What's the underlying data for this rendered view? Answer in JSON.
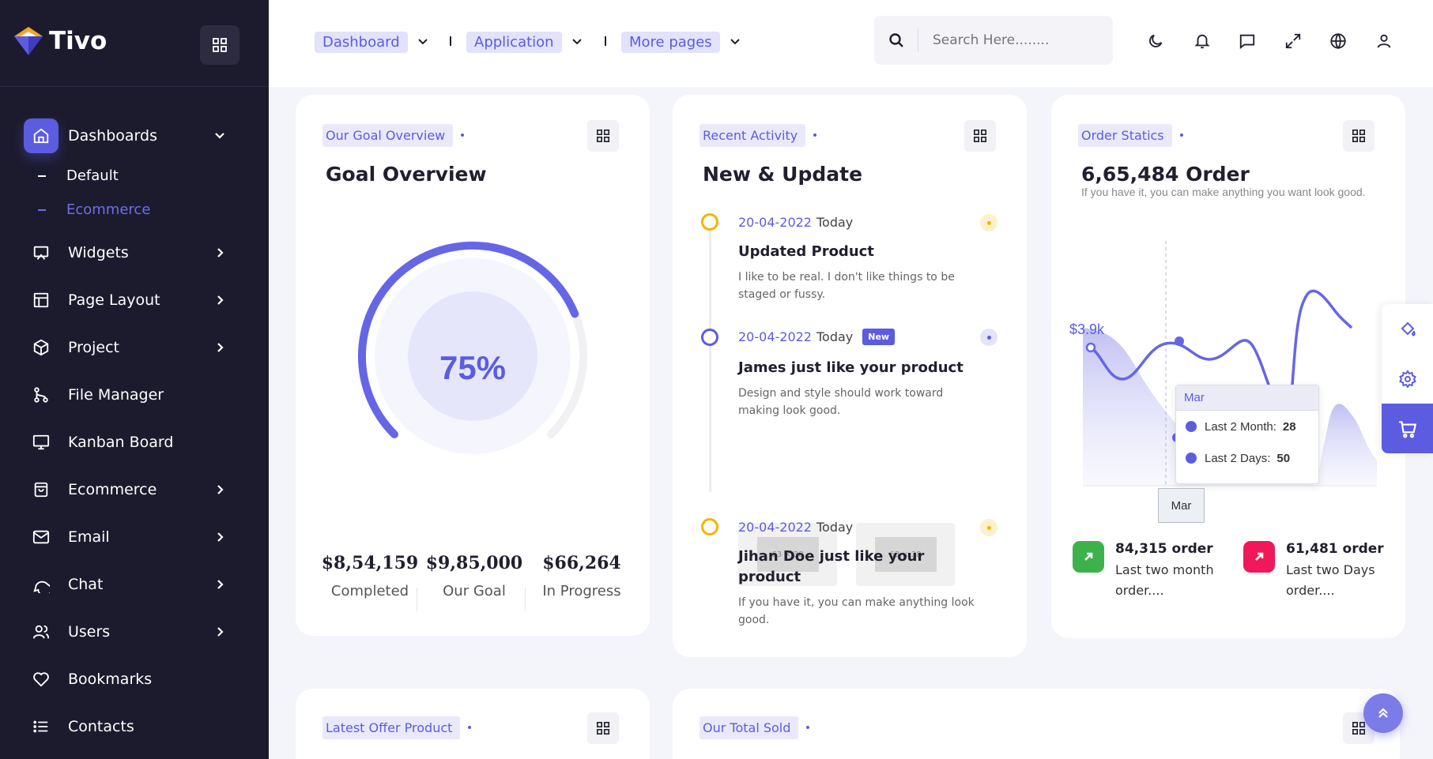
{
  "brand": {
    "name": "Tivo"
  },
  "sidebar": {
    "items": [
      {
        "label": "Dashboards",
        "icon": "home-icon"
      },
      {
        "label": "Widgets",
        "icon": "widget-icon"
      },
      {
        "label": "Page Layout",
        "icon": "layout-icon"
      },
      {
        "label": "Project",
        "icon": "box-icon"
      },
      {
        "label": "File Manager",
        "icon": "git-icon"
      },
      {
        "label": "Kanban Board",
        "icon": "monitor-icon"
      },
      {
        "label": "Ecommerce",
        "icon": "bag-icon"
      },
      {
        "label": "Email",
        "icon": "mail-icon"
      },
      {
        "label": "Chat",
        "icon": "chat-icon"
      },
      {
        "label": "Users",
        "icon": "users-icon"
      },
      {
        "label": "Bookmarks",
        "icon": "heart-icon"
      },
      {
        "label": "Contacts",
        "icon": "list-icon"
      }
    ],
    "sub_items": [
      "Default",
      "Ecommerce"
    ]
  },
  "topbar": {
    "links": [
      "Dashboard",
      "Application",
      "More pages"
    ],
    "search_placeholder": "Search Here........"
  },
  "goal": {
    "tag": "Our Goal Overview",
    "title": "Goal Overview",
    "percent_label": "75%",
    "percent": 75,
    "stats": [
      {
        "value": "$8,54,159",
        "label": "Completed"
      },
      {
        "value": "$9,85,000",
        "label": "Our Goal"
      },
      {
        "value": "$66,264",
        "label": "In Progress"
      }
    ]
  },
  "activity": {
    "tag": "Recent Activity",
    "title": "New & Update",
    "items": [
      {
        "date": "20-04-2022",
        "day": "Today",
        "title": "Updated Product",
        "desc": "I like to be real. I don't like things to be staged or fussy."
      },
      {
        "date": "20-04-2022",
        "day": "Today",
        "badge": "New",
        "title": "James just like your product",
        "desc": "Design and style should work toward making look good."
      },
      {
        "date": "20-04-2022",
        "day": "Today",
        "title": "Jihan Doe just like your product",
        "desc": "If you have it, you can make anything look good."
      }
    ],
    "thumbs": [
      "63 × 38",
      "63 × 38"
    ]
  },
  "order": {
    "tag": "Order Statics",
    "title": "6,65,484 Order",
    "subtitle": "If you have it, you can make anything you want look good.",
    "y_label": "$3.9k",
    "tooltip": {
      "header": "Mar",
      "rows": [
        {
          "name": "Last 2 Month:",
          "value": "28"
        },
        {
          "name": "Last 2 Days:",
          "value": "50"
        }
      ]
    },
    "x_label": "Mar",
    "stats": [
      {
        "value": "84,315 order",
        "label": "Last two month order....",
        "color": "#3db24b"
      },
      {
        "value": "61,481 order",
        "label": "Last two Days order....",
        "color": "#f0185a"
      }
    ]
  },
  "bottom_cards": [
    {
      "tag": "Latest Offer Product"
    },
    {
      "tag": "Our Total Sold"
    }
  ],
  "colors": {
    "accent": "#5b5ce0",
    "sidebar": "#1c1b2e"
  }
}
